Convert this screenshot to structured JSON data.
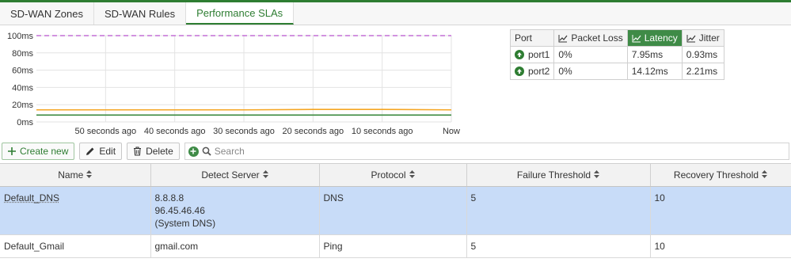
{
  "tabs": [
    {
      "label": "SD-WAN Zones",
      "active": false
    },
    {
      "label": "SD-WAN Rules",
      "active": false
    },
    {
      "label": "Performance SLAs",
      "active": true
    }
  ],
  "chart_data": {
    "type": "line",
    "y_ticks": [
      "0ms",
      "20ms",
      "40ms",
      "60ms",
      "80ms",
      "100ms"
    ],
    "x_ticks": [
      "50 seconds ago",
      "40 seconds ago",
      "30 seconds ago",
      "20 seconds ago",
      "10 seconds ago",
      "Now"
    ],
    "x": [
      60,
      50,
      40,
      30,
      20,
      10,
      0
    ],
    "ylim": [
      0,
      100
    ],
    "series": [
      {
        "values": [
          100,
          100,
          100,
          100,
          100,
          100,
          100
        ],
        "color": "#c36fd6",
        "dashed": true
      },
      {
        "values": [
          14,
          14,
          14,
          14,
          14.5,
          14.5,
          14
        ],
        "color": "#f5a623"
      },
      {
        "values": [
          8,
          8,
          8,
          8,
          8,
          8,
          8
        ],
        "color": "#3b8a3e"
      }
    ]
  },
  "stats": {
    "headers": [
      {
        "label": "Port",
        "icon": "",
        "active": false
      },
      {
        "label": "Packet Loss",
        "icon": "line-chart-icon",
        "active": false
      },
      {
        "label": "Latency",
        "icon": "line-chart-icon",
        "active": true
      },
      {
        "label": "Jitter",
        "icon": "line-chart-icon",
        "active": false
      }
    ],
    "rows": [
      {
        "port": "port1",
        "status_icon": "arrow-up-circle-icon",
        "packet_loss": "0%",
        "latency": "7.95ms",
        "jitter": "0.93ms"
      },
      {
        "port": "port2",
        "status_icon": "arrow-up-circle-icon",
        "packet_loss": "0%",
        "latency": "14.12ms",
        "jitter": "2.21ms"
      }
    ]
  },
  "toolbar": {
    "create_label": "Create new",
    "edit_label": "Edit",
    "delete_label": "Delete",
    "search_placeholder": "Search"
  },
  "table": {
    "columns": [
      "Name",
      "Detect Server",
      "Protocol",
      "Failure Threshold",
      "Recovery Threshold"
    ],
    "rows": [
      {
        "name": "Default_DNS",
        "server": [
          "8.8.8.8",
          "96.45.46.46",
          "(System DNS)"
        ],
        "protocol": "DNS",
        "failure": "5",
        "recovery": "10",
        "selected": true
      },
      {
        "name": "Default_Gmail",
        "server": [
          "gmail.com"
        ],
        "protocol": "Ping",
        "failure": "5",
        "recovery": "10",
        "selected": false
      }
    ]
  },
  "colors": {
    "accent": "#2e7d32",
    "selected_row": "#c8dcf8",
    "latency_active": "#3f8b47"
  }
}
